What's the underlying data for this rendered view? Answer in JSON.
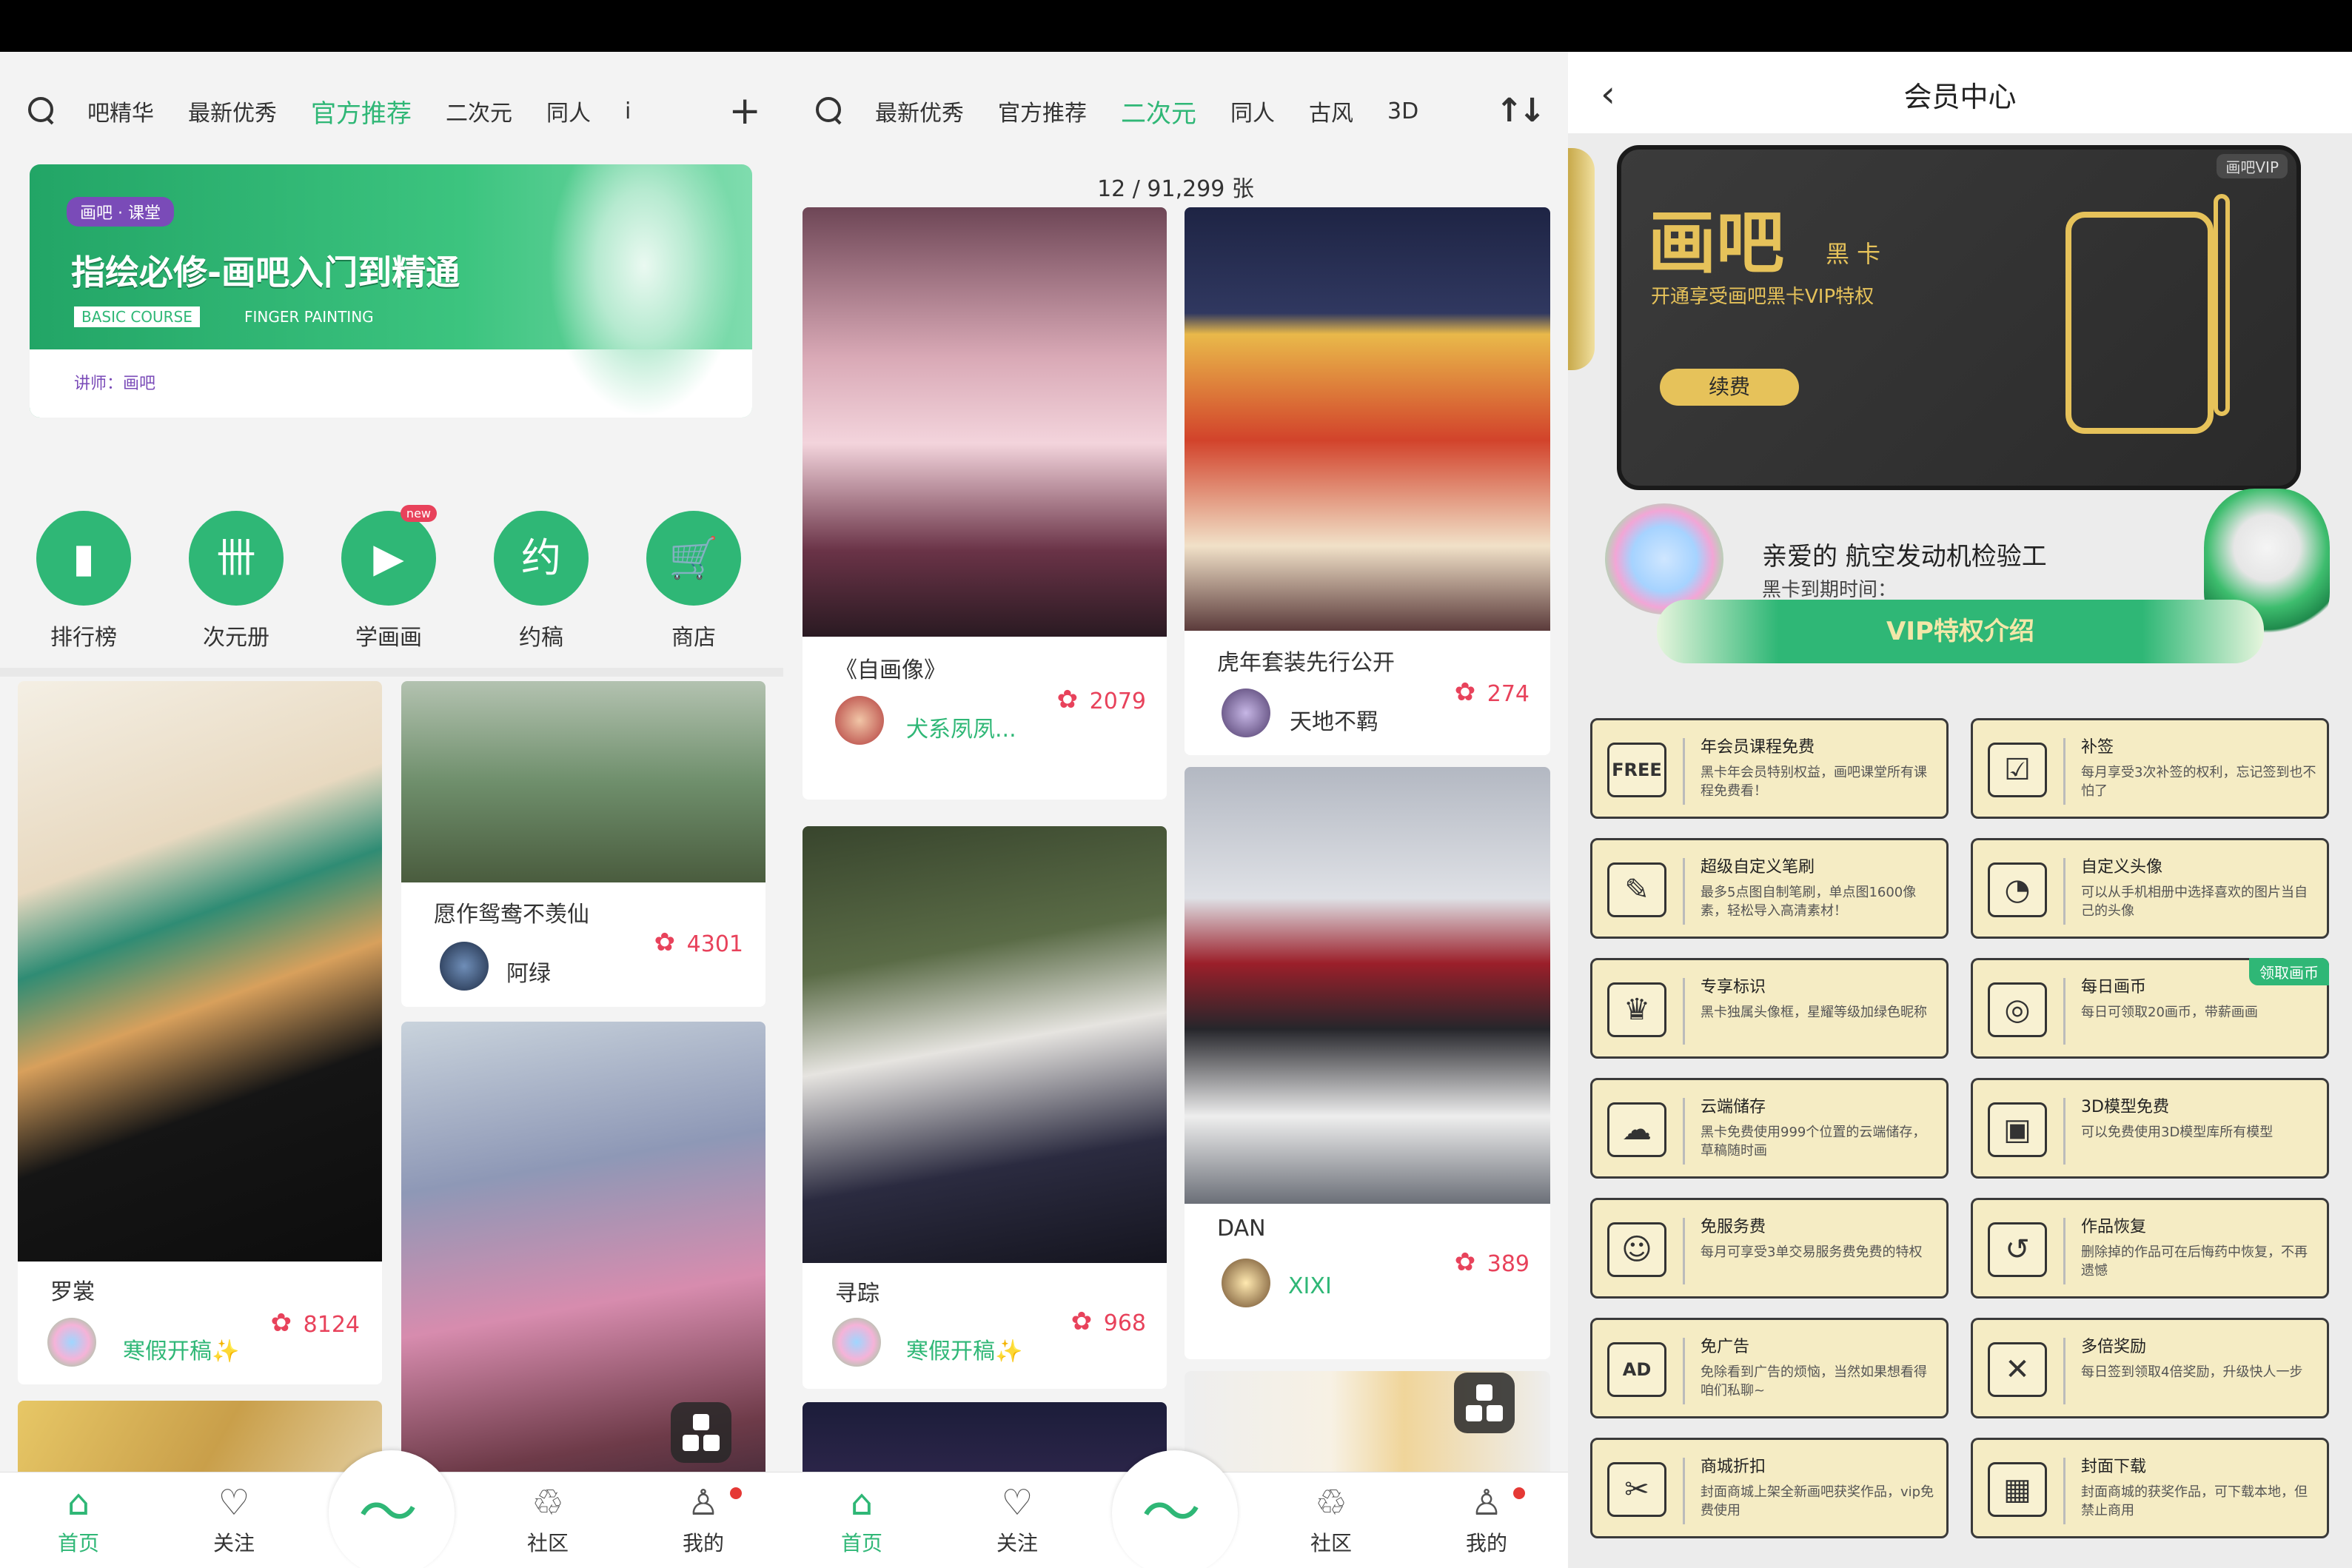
{
  "colors": {
    "accent": "#2fb776",
    "like": "#e8425b",
    "gold": "#c8a94a"
  },
  "panel1": {
    "tabs": [
      "吧精华",
      "最新优秀",
      "官方推荐",
      "二次元",
      "同人",
      "i"
    ],
    "active_tab": "官方推荐",
    "banner": {
      "tag": "画吧 · 课堂",
      "title": "指绘必修-画吧入门到精通",
      "sub1": "BASIC COURSE",
      "sub2": "FINGER PAINTING",
      "teacher": "讲师：画吧"
    },
    "shortcuts": [
      {
        "label": "排行榜",
        "icon": "bar-chart-icon"
      },
      {
        "label": "次元册",
        "icon": "book-icon"
      },
      {
        "label": "学画画",
        "icon": "play-icon",
        "badge": "new"
      },
      {
        "label": "约稿",
        "icon": "commission-icon"
      },
      {
        "label": "商店",
        "icon": "cart-icon"
      }
    ],
    "posts": [
      {
        "title": "罗裳",
        "user": "寒假开稿✨",
        "likes": "8124"
      },
      {
        "title": "愿作鸳鸯不羡仙",
        "user": "阿绿",
        "likes": "4301"
      }
    ]
  },
  "panel2": {
    "tabs": [
      "最新优秀",
      "官方推荐",
      "二次元",
      "同人",
      "古风",
      "3D"
    ],
    "active_tab": "二次元",
    "counter": "12 / 91,299 张",
    "posts": [
      {
        "title": "《自画像》",
        "user": "犬系夙夙...",
        "likes": "2079"
      },
      {
        "title": "虎年套装先行公开",
        "user": "天地不羁",
        "likes": "274"
      },
      {
        "title": "寻踪",
        "user": "寒假开稿✨",
        "likes": "968"
      },
      {
        "title": "DAN",
        "user": "XIXI",
        "likes": "389"
      }
    ]
  },
  "nav": [
    {
      "label": "首页",
      "icon": "home-icon"
    },
    {
      "label": "关注",
      "icon": "heart-icon"
    },
    {
      "label": "社区",
      "icon": "community-icon"
    },
    {
      "label": "我的",
      "icon": "profile-icon"
    }
  ],
  "panel3": {
    "title": "会员中心",
    "card": {
      "logo": "画吧",
      "type": "黑 卡",
      "desc": "开通享受画吧黑卡VIP特权",
      "renew": "续费",
      "corner": "画吧VIP"
    },
    "user": {
      "greeting": "亲爱的 航空发动机检验工",
      "expire": "黑卡到期时间："
    },
    "vip_banner": "VIP特权介绍",
    "features": [
      {
        "title": "年会员课程免费",
        "desc": "黑卡年会员特别权益，画吧课堂所有课程免费看！",
        "icon": "free-icon"
      },
      {
        "title": "补签",
        "desc": "每月享受3次补签的权利，忘记签到也不怕了",
        "icon": "calendar-icon"
      },
      {
        "title": "超级自定义笔刷",
        "desc": "最多5点图自制笔刷，单点图1600像素，轻松导入高清素材！",
        "icon": "brush-icon"
      },
      {
        "title": "自定义头像",
        "desc": "可以从手机相册中选择喜欢的图片当自己的头像",
        "icon": "avatar-icon"
      },
      {
        "title": "专享标识",
        "desc": "黑卡独属头像框，星耀等级加绿色昵称",
        "icon": "crown-icon"
      },
      {
        "title": "每日画币",
        "desc": "每日可领取20画币，带薪画画",
        "icon": "coin-icon",
        "badge": "领取画币"
      },
      {
        "title": "云端储存",
        "desc": "黑卡免费使用999个位置的云端储存，草稿随时画",
        "icon": "cloud-icon"
      },
      {
        "title": "3D模型免费",
        "desc": "可以免费使用3D模型库所有模型",
        "icon": "cube-icon"
      },
      {
        "title": "免服务费",
        "desc": "每月可享受3单交易服务费免费的特权",
        "icon": "service-icon"
      },
      {
        "title": "作品恢复",
        "desc": "删除掉的作品可在后悔药中恢复，不再遗憾",
        "icon": "restore-icon"
      },
      {
        "title": "免广告",
        "desc": "免除看到广告的烦恼，当然如果想看得咱们私聊~",
        "icon": "no-ad-icon"
      },
      {
        "title": "多倍奖励",
        "desc": "每日签到领取4倍奖励，升级快人一步",
        "icon": "multiplier-icon"
      },
      {
        "title": "商城折扣",
        "desc": "封面商城上架全新画吧获奖作品，vip免费使用",
        "icon": "ticket-icon"
      },
      {
        "title": "封面下载",
        "desc": "封面商城的获奖作品，可下载本地，但禁止商用",
        "icon": "image-download-icon"
      }
    ]
  }
}
